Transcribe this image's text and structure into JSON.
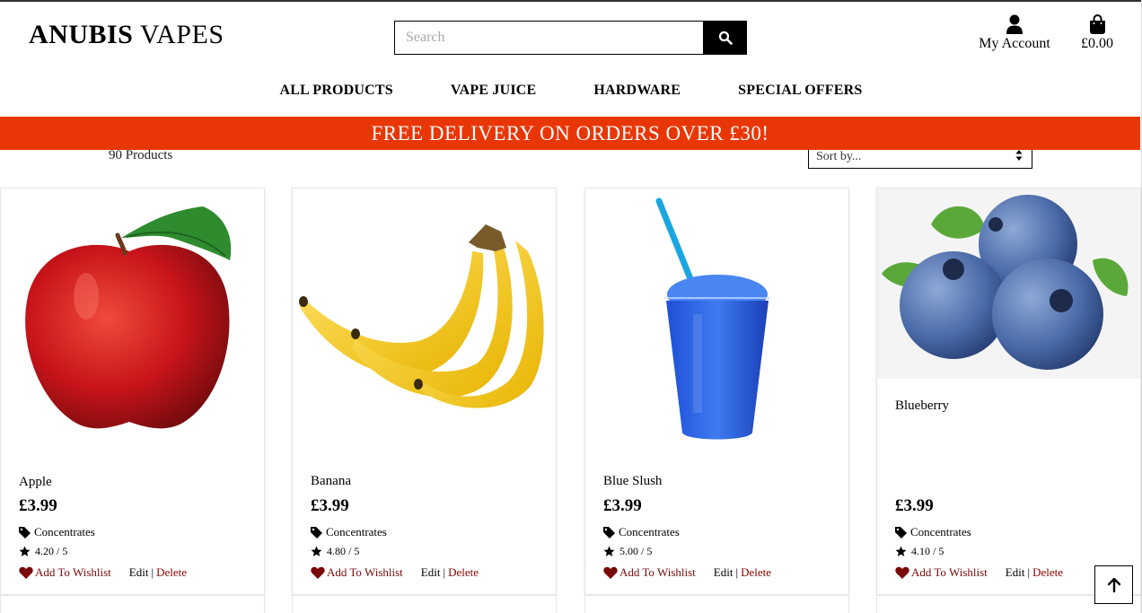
{
  "header": {
    "logo_bold": "ANUBIS",
    "logo_rest": "VAPES",
    "search_placeholder": "Search",
    "account_label": "My Account",
    "bag_total": "£0.00"
  },
  "nav": [
    "ALL PRODUCTS",
    "VAPE JUICE",
    "HARDWARE",
    "SPECIAL OFFERS"
  ],
  "banner": "FREE DELIVERY ON ORDERS OVER £30!",
  "listing": {
    "count": "90 Products",
    "sort_value": "Sort by..."
  },
  "products": [
    {
      "name": "Apple",
      "price": "£3.99",
      "category": "Concentrates",
      "rating": "4.20 / 5",
      "wishlist": "Add To Wishlist",
      "edit": "Edit",
      "sep": "|",
      "delete": "Delete"
    },
    {
      "name": "Banana",
      "price": "£3.99",
      "category": "Concentrates",
      "rating": "4.80 / 5",
      "wishlist": "Add To Wishlist",
      "edit": "Edit",
      "sep": "|",
      "delete": "Delete"
    },
    {
      "name": "Blue Slush",
      "price": "£3.99",
      "category": "Concentrates",
      "rating": "5.00 / 5",
      "wishlist": "Add To Wishlist",
      "edit": "Edit",
      "sep": "|",
      "delete": "Delete"
    },
    {
      "name": "Blueberry",
      "price": "£3.99",
      "category": "Concentrates",
      "rating": "4.10 / 5",
      "wishlist": "Add To Wishlist",
      "edit": "Edit",
      "sep": "|",
      "delete": "Delete"
    }
  ],
  "icons": {
    "search": "search-icon",
    "account": "user-icon",
    "bag": "shopping-bag-icon",
    "tag": "tag-icon",
    "star": "star-icon",
    "heart": "heart-icon",
    "to_top": "arrow-up-icon"
  },
  "colors": {
    "banner": "#e93606",
    "wishlist": "#7a0a0a",
    "delete": "#8b0000"
  }
}
